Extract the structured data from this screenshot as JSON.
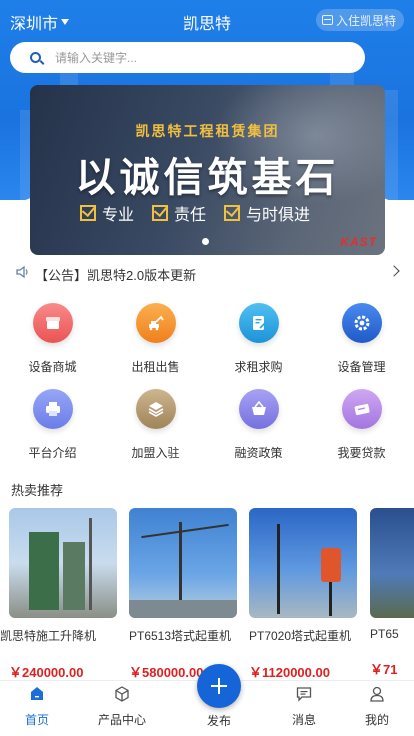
{
  "header": {
    "city": "深圳市",
    "title": "凯思特",
    "join_label": "入住凯思特"
  },
  "search": {
    "placeholder": "请输入关键字..."
  },
  "banner": {
    "subtitle": "凯思特工程租赁集团",
    "headline": "以诚信筑基石",
    "tags": [
      "专业",
      "责任",
      "与时俱进"
    ],
    "logo": "KAST"
  },
  "notice": {
    "text": "【公告】凯思特2.0版本更新"
  },
  "grid": {
    "items": [
      {
        "label": "设备商城",
        "icon": "store-icon",
        "color": "#f06a6a"
      },
      {
        "label": "出租出售",
        "icon": "excavator-icon",
        "color": "#f5922e"
      },
      {
        "label": "求租求购",
        "icon": "document-edit-icon",
        "color": "#2aa7e6"
      },
      {
        "label": "设备管理",
        "icon": "settings-icon",
        "color": "#2f6fd6"
      },
      {
        "label": "平台介绍",
        "icon": "printer-icon",
        "color": "#7b8cf0"
      },
      {
        "label": "加盟入驻",
        "icon": "layers-icon",
        "color": "#b59a6e"
      },
      {
        "label": "融资政策",
        "icon": "basket-icon",
        "color": "#8a86ea"
      },
      {
        "label": "我要贷款",
        "icon": "ticket-icon",
        "color": "#b58ae6"
      }
    ]
  },
  "hot": {
    "title": "热卖推荐",
    "products": [
      {
        "name": "凯思特施工升降机",
        "price": "￥240000.00"
      },
      {
        "name": "PT6513塔式起重机",
        "price": "￥580000.00"
      },
      {
        "name": "PT7020塔式起重机",
        "price": "￥1120000.00"
      },
      {
        "name": "PT65",
        "price": "￥71"
      }
    ]
  },
  "tabbar": {
    "items": [
      {
        "label": "首页",
        "icon": "home-icon"
      },
      {
        "label": "产品中心",
        "icon": "cube-icon"
      },
      {
        "label": "发布",
        "icon": "plus-icon"
      },
      {
        "label": "消息",
        "icon": "message-icon"
      },
      {
        "label": "我的",
        "icon": "user-icon"
      }
    ]
  },
  "colors": {
    "primary": "#1a73e0",
    "price": "#e02020",
    "accent": "#f0c040"
  }
}
